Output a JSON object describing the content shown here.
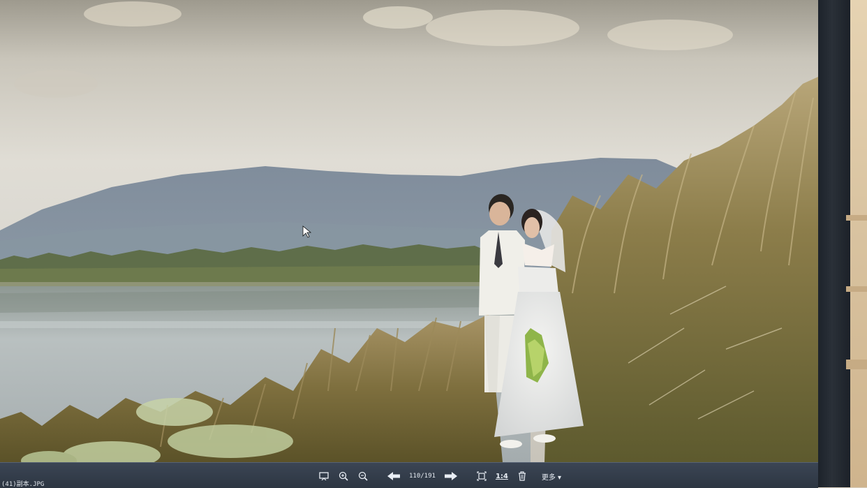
{
  "viewer": {
    "filename": "(41)副本.JPG",
    "counter": "110/191",
    "ratio_label": "1:4",
    "more_label": "更多 ▾"
  },
  "toolbar_icons": [
    "slideshow-icon",
    "zoom-in-icon",
    "zoom-out-icon",
    "previous-arrow-icon",
    "next-arrow-icon",
    "fit-to-window-icon",
    "actual-size-icon",
    "delete-icon",
    "more-menu"
  ],
  "colors": {
    "toolbar": "#2f3844",
    "sky": "#dedbd2",
    "mountain": "#7c8a99",
    "water": "#aab0b0",
    "grass": "#8a7a48"
  }
}
